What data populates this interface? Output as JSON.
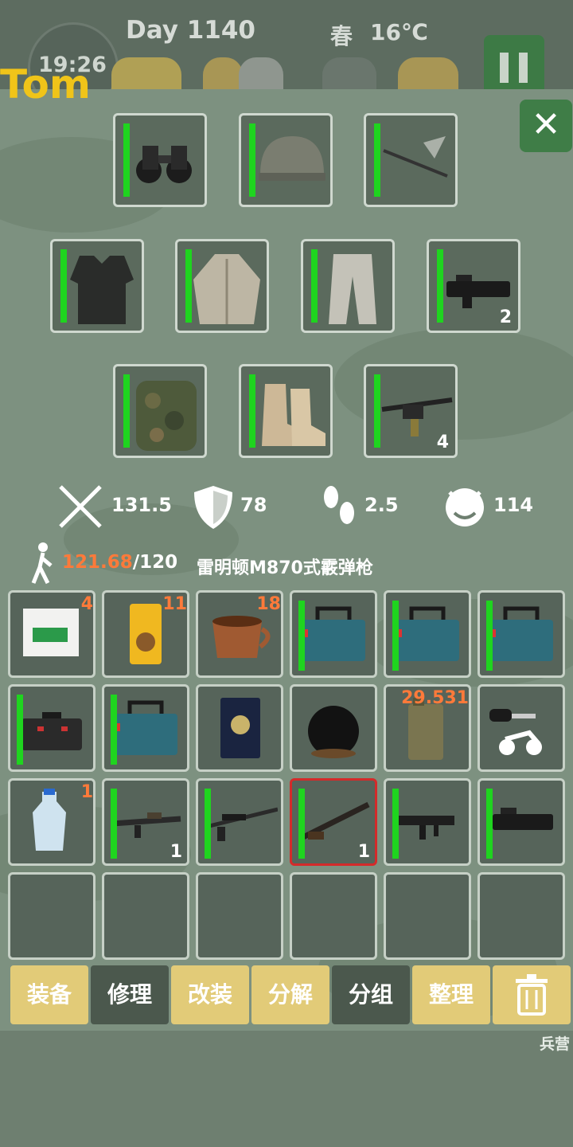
{
  "hud": {
    "day": "Day 1140",
    "season": "春",
    "temperature": "16℃",
    "time": "19:26",
    "name_partial": "Tom"
  },
  "equipment": [
    {
      "name": "binoculars",
      "icon": "binoculars-icon",
      "count": ""
    },
    {
      "name": "tactical-helmet",
      "icon": "helmet-icon",
      "count": ""
    },
    {
      "name": "spear",
      "icon": "spear-icon",
      "count": ""
    },
    {
      "name": "body-armor",
      "icon": "vest-icon",
      "count": ""
    },
    {
      "name": "jacket",
      "icon": "jacket-icon",
      "count": ""
    },
    {
      "name": "pants",
      "icon": "pants-icon",
      "count": ""
    },
    {
      "name": "p90-smg",
      "icon": "smg-icon",
      "count": "2"
    },
    {
      "name": "camo-backpack",
      "icon": "backpack-icon",
      "count": ""
    },
    {
      "name": "desert-boots",
      "icon": "boots-icon",
      "count": ""
    },
    {
      "name": "machine-gun",
      "icon": "machine-gun-icon",
      "count": "4"
    }
  ],
  "stats": {
    "attack": "131.5",
    "defense": "78",
    "speed": "2.5",
    "threat": "114"
  },
  "weight": {
    "current": "121.68",
    "max": "/120"
  },
  "selected_weapon_name": "雷明顿M870式霰弹枪",
  "inventory": [
    {
      "icon": "compressed-food-icon",
      "top": "4",
      "bottom": "",
      "dur": false
    },
    {
      "icon": "dog-food-icon",
      "top": "11",
      "bottom": "",
      "dur": false
    },
    {
      "icon": "clay-cup-icon",
      "top": "18",
      "bottom": "",
      "dur": false
    },
    {
      "icon": "toolbox-icon",
      "top": "",
      "bottom": "",
      "dur": true
    },
    {
      "icon": "toolbox-icon",
      "top": "",
      "bottom": "",
      "dur": true
    },
    {
      "icon": "toolbox-icon",
      "top": "",
      "bottom": "",
      "dur": true
    },
    {
      "icon": "black-case-icon",
      "top": "",
      "bottom": "",
      "dur": true
    },
    {
      "icon": "toolbox-icon",
      "top": "",
      "bottom": "",
      "dur": true
    },
    {
      "icon": "passport-icon",
      "top": "",
      "bottom": "",
      "dur": false
    },
    {
      "icon": "iron-ball-icon",
      "top": "",
      "bottom": "",
      "dur": false
    },
    {
      "icon": "jerry-can-icon",
      "top": "29.531",
      "bottom": "",
      "dur": false
    },
    {
      "icon": "motorbike-key-icon",
      "top": "",
      "bottom": "",
      "dur": false
    },
    {
      "icon": "water-bottle-icon",
      "top": "1",
      "bottom": "",
      "dur": false
    },
    {
      "icon": "assault-rifle-icon",
      "top": "",
      "bottom": "1",
      "dur": true
    },
    {
      "icon": "sniper-rifle-icon",
      "top": "",
      "bottom": "",
      "dur": true
    },
    {
      "icon": "shotgun-icon",
      "top": "",
      "bottom": "1",
      "dur": true,
      "selected": true
    },
    {
      "icon": "mp5-icon",
      "top": "",
      "bottom": "",
      "dur": true
    },
    {
      "icon": "p90-icon",
      "top": "",
      "bottom": "",
      "dur": true
    },
    {
      "icon": "",
      "top": "",
      "bottom": "",
      "dur": false
    },
    {
      "icon": "",
      "top": "",
      "bottom": "",
      "dur": false
    },
    {
      "icon": "",
      "top": "",
      "bottom": "",
      "dur": false
    },
    {
      "icon": "",
      "top": "",
      "bottom": "",
      "dur": false
    },
    {
      "icon": "",
      "top": "",
      "bottom": "",
      "dur": false
    },
    {
      "icon": "",
      "top": "",
      "bottom": "",
      "dur": false
    }
  ],
  "actions": {
    "equip": "装备",
    "repair": "修理",
    "modify": "改装",
    "disassemble": "分解",
    "group": "分组",
    "sort": "整理",
    "delete_icon": "trash-icon"
  },
  "barracks_label": "兵营"
}
